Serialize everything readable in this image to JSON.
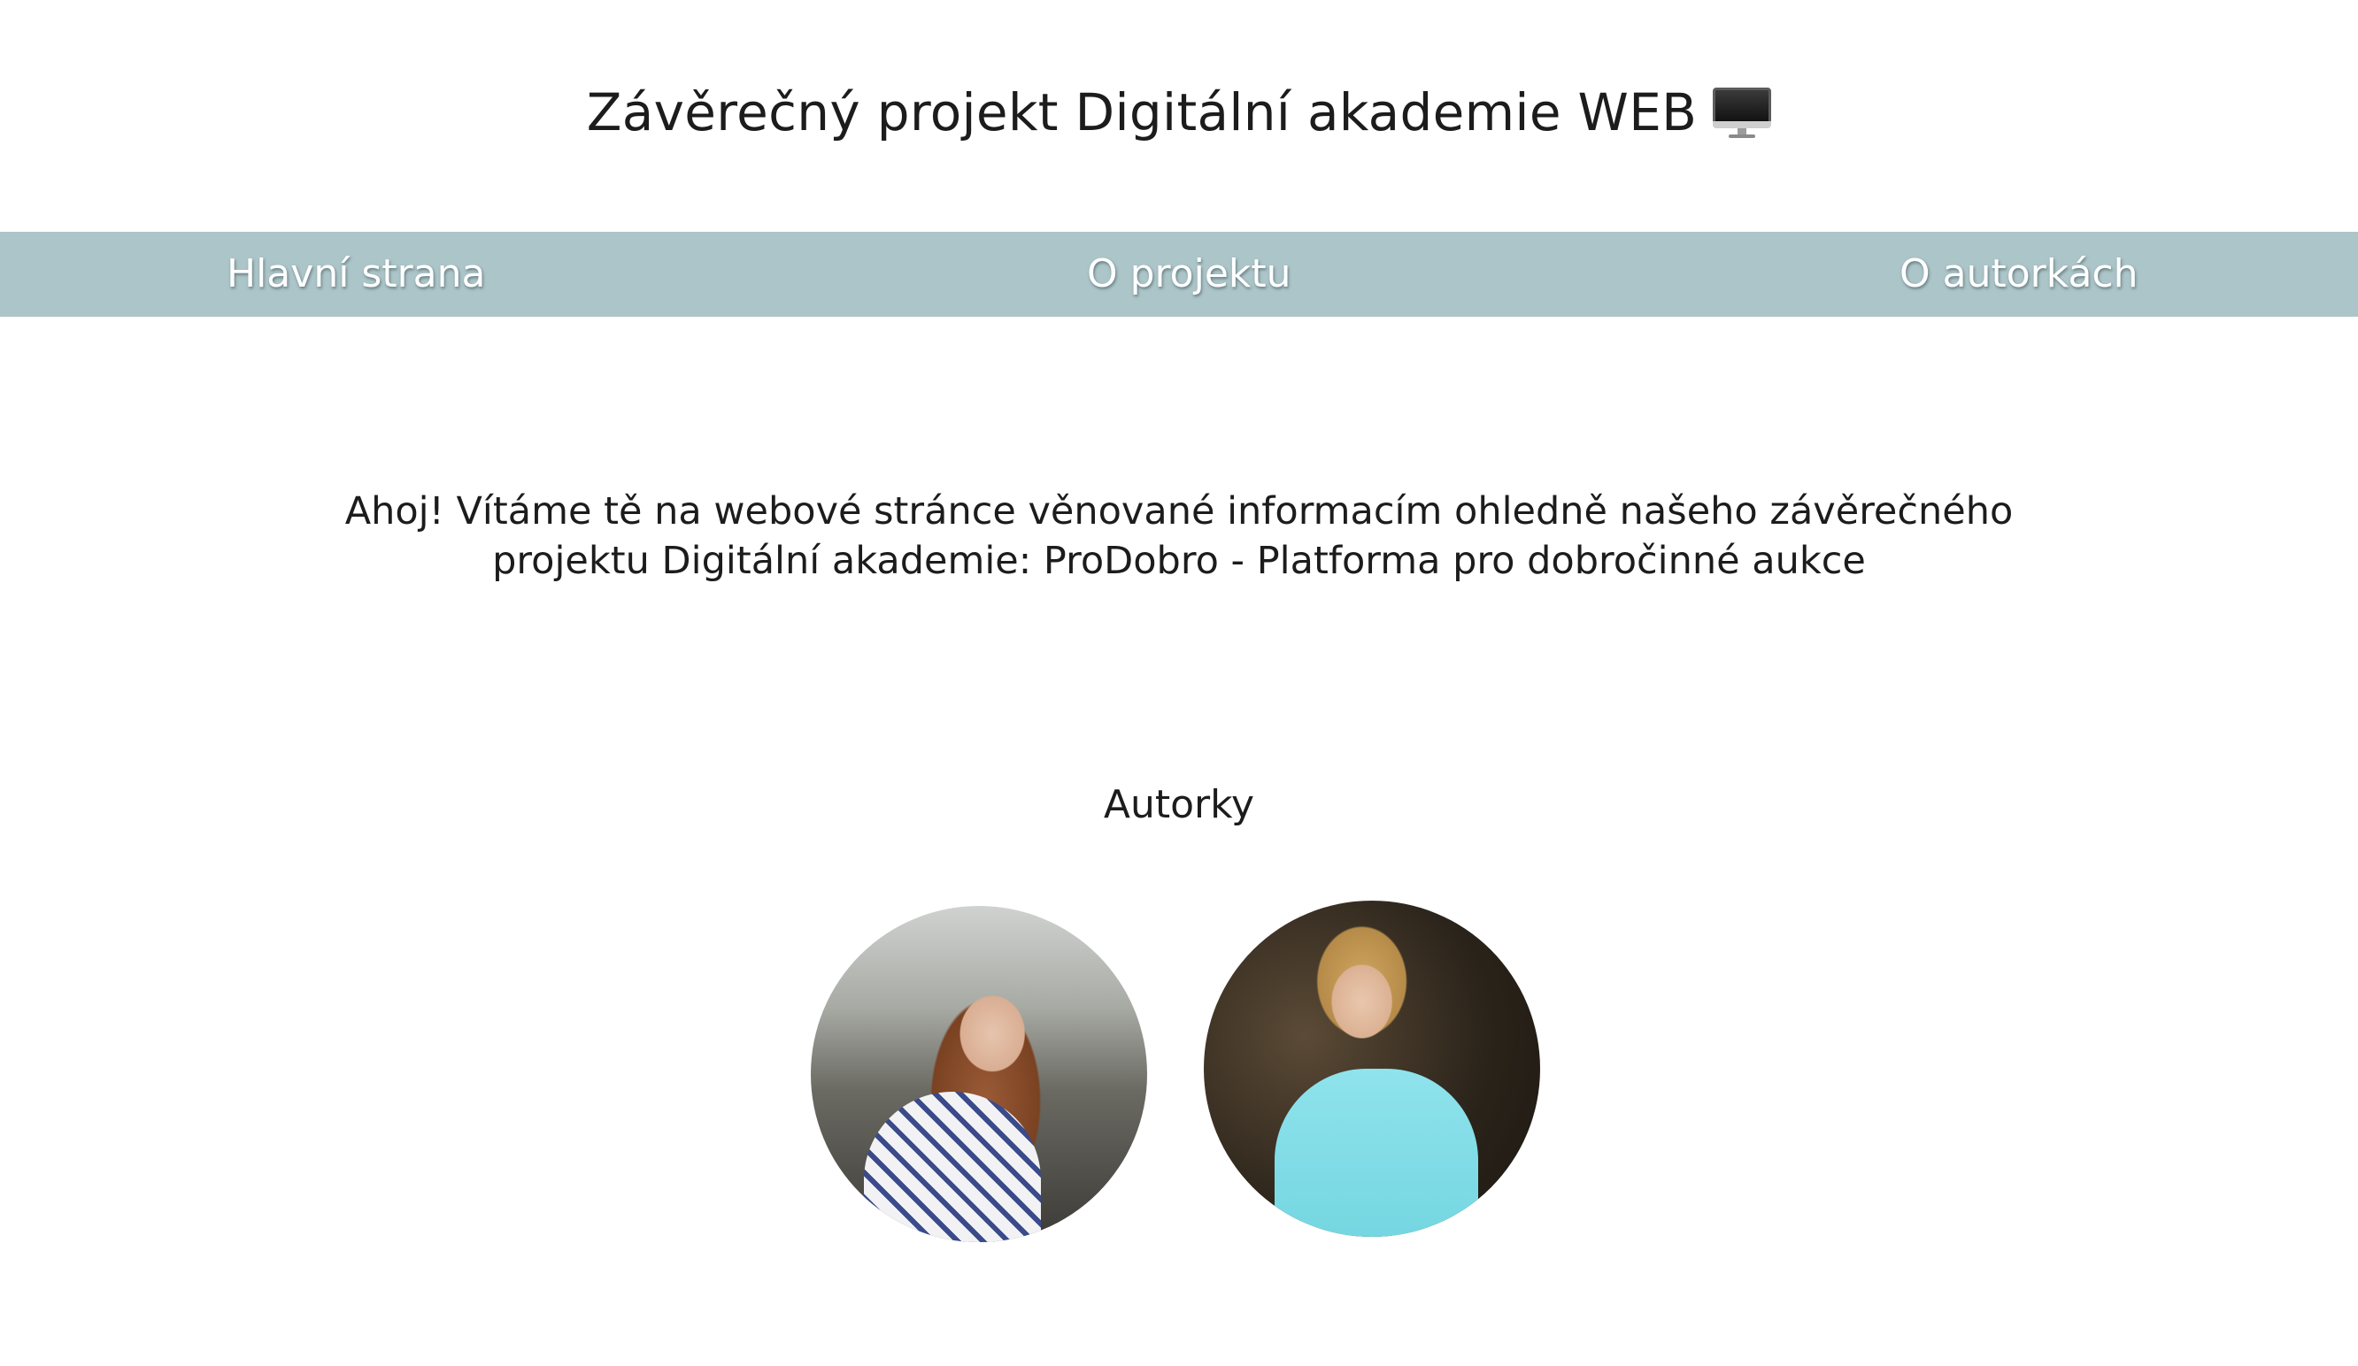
{
  "header": {
    "title": "Závěrečný projekt Digitální akademie WEB",
    "title_icon": "desktop-computer-icon"
  },
  "nav": {
    "items": [
      {
        "label": "Hlavní strana"
      },
      {
        "label": "O projektu"
      },
      {
        "label": "O autorkách"
      }
    ],
    "background_color": "#acc5c9"
  },
  "intro": {
    "text": "Ahoj! Vítáme tě na webové stránce věnované informacím ohledně našeho závěrečného projektu Digitální akademie: ProDobro - Platforma pro dobročinné aukce"
  },
  "authors": {
    "heading": "Autorky",
    "photos": [
      {
        "alt": ""
      },
      {
        "alt": ""
      }
    ]
  }
}
